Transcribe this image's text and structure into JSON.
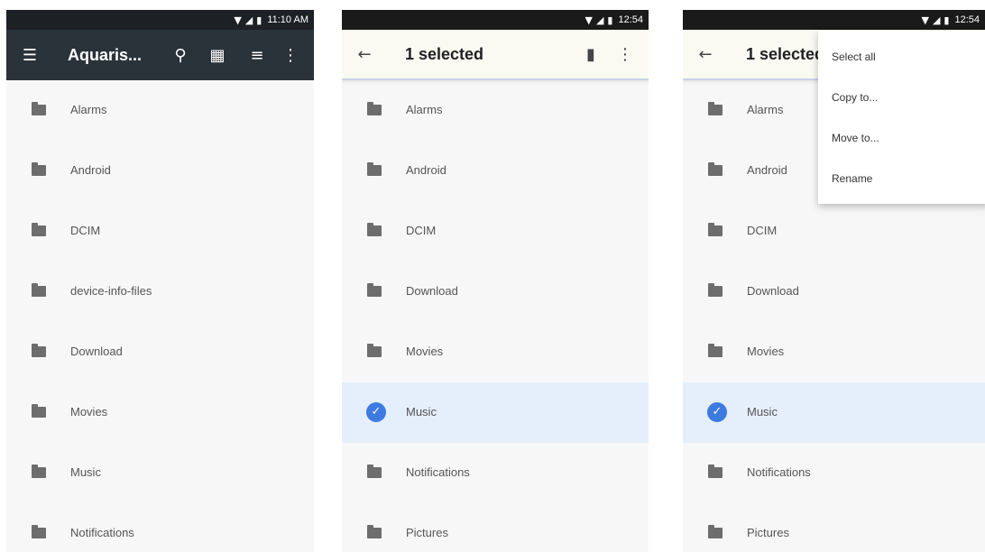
{
  "screens": [
    {
      "status": {
        "time": "11:10 AM",
        "wifi_icon": "wifi-icon",
        "signal_icon": "signal-icon",
        "battery_icon": "battery-icon"
      },
      "appbar": {
        "title": "Aquaris...",
        "menu_icon": "hamburger-icon",
        "search_icon": "search-icon",
        "grid_icon": "grid-view-icon",
        "sort_icon": "sort-icon",
        "overflow_icon": "more-vert-icon"
      },
      "rows": [
        {
          "label": "Alarms",
          "selected": false
        },
        {
          "label": "Android",
          "selected": false
        },
        {
          "label": "DCIM",
          "selected": false
        },
        {
          "label": "device-info-files",
          "selected": false
        },
        {
          "label": "Download",
          "selected": false
        },
        {
          "label": "Movies",
          "selected": false
        },
        {
          "label": "Music",
          "selected": false
        },
        {
          "label": "Notifications",
          "selected": false
        }
      ]
    },
    {
      "status": {
        "time": "12:54",
        "wifi_icon": "wifi-icon",
        "signal_icon": "signal-icon",
        "battery_icon": "battery-icon"
      },
      "appbar": {
        "title": "1 selected",
        "back_icon": "back-arrow-icon",
        "delete_icon": "trash-icon",
        "overflow_icon": "more-vert-icon"
      },
      "rows": [
        {
          "label": "Alarms",
          "selected": false
        },
        {
          "label": "Android",
          "selected": false
        },
        {
          "label": "DCIM",
          "selected": false
        },
        {
          "label": "Download",
          "selected": false
        },
        {
          "label": "Movies",
          "selected": false
        },
        {
          "label": "Music",
          "selected": true
        },
        {
          "label": "Notifications",
          "selected": false
        },
        {
          "label": "Pictures",
          "selected": false
        }
      ]
    },
    {
      "status": {
        "time": "12:54",
        "wifi_icon": "wifi-icon",
        "signal_icon": "signal-icon",
        "battery_icon": "battery-icon"
      },
      "appbar": {
        "title": "1 selected",
        "back_icon": "back-arrow-icon"
      },
      "rows": [
        {
          "label": "Alarms",
          "selected": false
        },
        {
          "label": "Android",
          "selected": false
        },
        {
          "label": "DCIM",
          "selected": false
        },
        {
          "label": "Download",
          "selected": false
        },
        {
          "label": "Movies",
          "selected": false
        },
        {
          "label": "Music",
          "selected": true
        },
        {
          "label": "Notifications",
          "selected": false
        },
        {
          "label": "Pictures",
          "selected": false
        }
      ],
      "overflow_menu": [
        "Select all",
        "Copy to...",
        "Move to...",
        "Rename"
      ]
    }
  ],
  "colors": {
    "browse_appbar": "#2a323a",
    "browse_statusbar": "#1d2126",
    "selection_appbar": "#fafaf3",
    "selected_row": "#e5eefb",
    "check_blue": "#3d7be0",
    "folder_grey": "#6d6d6d",
    "list_background": "#f7f7f7"
  }
}
